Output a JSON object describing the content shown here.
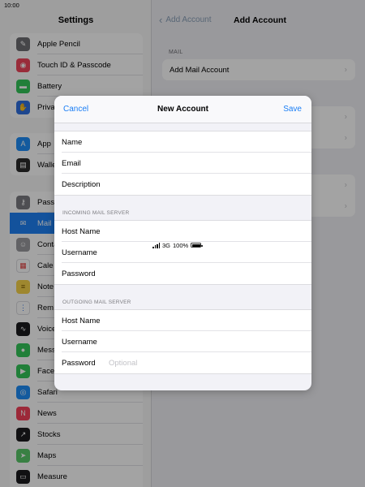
{
  "status_bar": {
    "time": "10:00",
    "network": "3G",
    "battery": "100%"
  },
  "settings": {
    "title": "Settings",
    "group1": [
      {
        "label": "Apple Pencil",
        "icon": "pencil-icon",
        "color": "#6e6e73"
      },
      {
        "label": "Touch ID & Passcode",
        "icon": "fingerprint-icon",
        "color": "#f0455b"
      },
      {
        "label": "Battery",
        "icon": "battery-icon",
        "color": "#34c759"
      },
      {
        "label": "Priva",
        "icon": "hand-icon",
        "color": "#2f6fe0"
      }
    ],
    "group2": [
      {
        "label": "App",
        "icon": "app-store-icon",
        "color": "#1e8ef7"
      },
      {
        "label": "Walle",
        "icon": "wallet-icon",
        "color": "#2b2b2b"
      }
    ],
    "group3": [
      {
        "label": "Pass",
        "icon": "key-icon",
        "color": "#7b7b80"
      },
      {
        "label": "Mail",
        "icon": "mail-icon",
        "color": "#1e80f5",
        "selected": true
      },
      {
        "label": "Conta",
        "icon": "contacts-icon",
        "color": "#9a9a9f"
      },
      {
        "label": "Cale",
        "icon": "calendar-icon",
        "color": "#ffffff"
      },
      {
        "label": "Note",
        "icon": "notes-icon",
        "color": "#f8d34a"
      },
      {
        "label": "Rem",
        "icon": "reminders-icon",
        "color": "#ffffff"
      },
      {
        "label": "Voice",
        "icon": "voice-memos-icon",
        "color": "#1c1c1e"
      },
      {
        "label": "Mess",
        "icon": "messages-icon",
        "color": "#34c759"
      },
      {
        "label": "Face",
        "icon": "facetime-icon",
        "color": "#34c759"
      },
      {
        "label": "Safari",
        "icon": "safari-icon",
        "color": "#1e8ef7"
      },
      {
        "label": "News",
        "icon": "news-icon",
        "color": "#f5405a"
      },
      {
        "label": "Stocks",
        "icon": "stocks-icon",
        "color": "#1c1c1e"
      },
      {
        "label": "Maps",
        "icon": "maps-icon",
        "color": "#5ac86a"
      },
      {
        "label": "Measure",
        "icon": "measure-icon",
        "color": "#1c1c1e"
      }
    ]
  },
  "right_panel": {
    "back_label": "Add Account",
    "title": "Add Account",
    "mail_header": "MAIL",
    "add_mail_account": "Add Mail Account"
  },
  "modal": {
    "cancel": "Cancel",
    "title": "New Account",
    "save": "Save",
    "account_fields": [
      {
        "label": "Name",
        "value": "",
        "placeholder": ""
      },
      {
        "label": "Email",
        "value": "",
        "placeholder": ""
      },
      {
        "label": "Description",
        "value": "",
        "placeholder": ""
      }
    ],
    "incoming_header": "INCOMING MAIL SERVER",
    "incoming_fields": [
      {
        "label": "Host Name",
        "value": "",
        "placeholder": ""
      },
      {
        "label": "Username",
        "value": "",
        "placeholder": ""
      },
      {
        "label": "Password",
        "value": "",
        "placeholder": ""
      }
    ],
    "outgoing_header": "OUTGOING MAIL SERVER",
    "outgoing_fields": [
      {
        "label": "Host Name",
        "value": "",
        "placeholder": ""
      },
      {
        "label": "Username",
        "value": "",
        "placeholder": ""
      },
      {
        "label": "Password",
        "value": "",
        "placeholder": "Optional"
      }
    ]
  }
}
